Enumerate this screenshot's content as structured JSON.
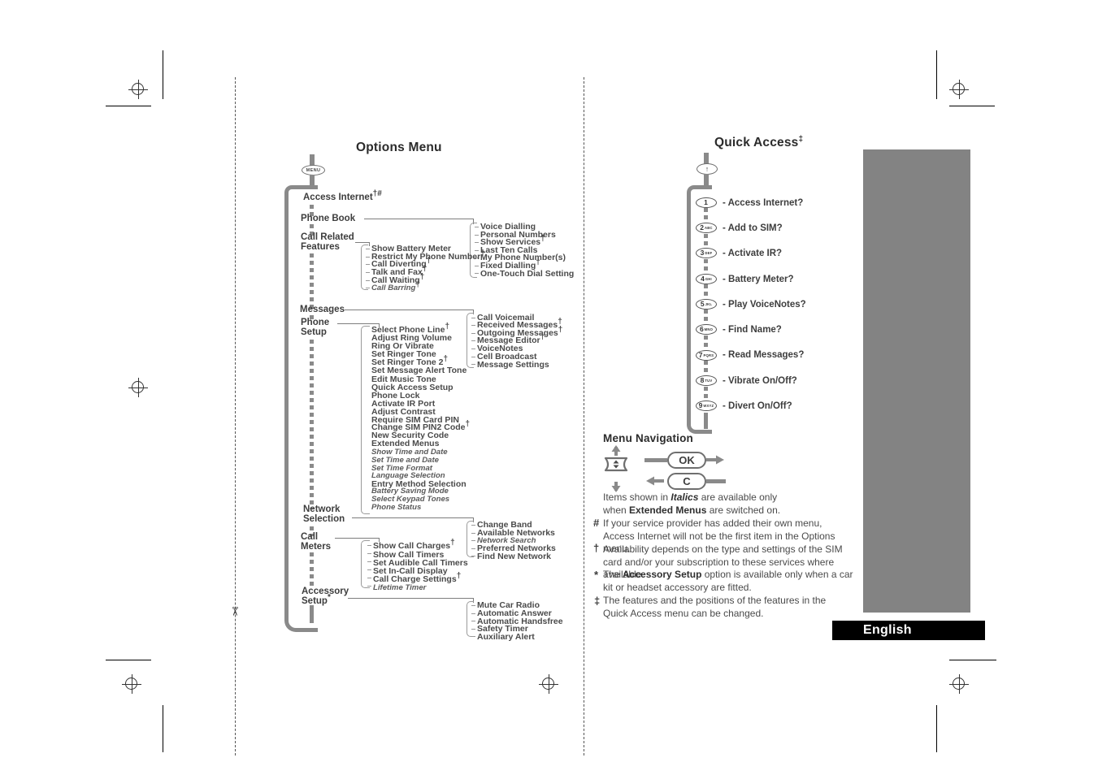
{
  "page": {
    "language_label": "English",
    "cut_icon": "scissors-icon"
  },
  "options_menu": {
    "title": "Options Menu",
    "root_key": "MENU",
    "items": [
      {
        "label": "Access Internet",
        "marks": "†#",
        "children": []
      },
      {
        "label": "Phone Book",
        "marks": "",
        "children": [
          {
            "label": "Voice Dialling",
            "marks": "",
            "italic": false
          },
          {
            "label": "Personal Numbers",
            "marks": "",
            "italic": false
          },
          {
            "label": "Show Services",
            "marks": "†",
            "italic": false
          },
          {
            "label": "Last Ten Calls",
            "marks": "",
            "italic": false
          },
          {
            "label": "My Phone Number(s)",
            "marks": "",
            "italic": false
          },
          {
            "label": "Fixed Dialling",
            "marks": "†",
            "italic": false
          },
          {
            "label": "One-Touch Dial Setting",
            "marks": "",
            "italic": false
          }
        ]
      },
      {
        "label": "Call Related\nFeatures",
        "marks": "",
        "children": [
          {
            "label": "Show Battery Meter",
            "marks": "",
            "italic": false
          },
          {
            "label": "Restrict My Phone Number",
            "marks": "†",
            "italic": false
          },
          {
            "label": "Call Diverting",
            "marks": "†",
            "italic": false
          },
          {
            "label": "Talk and Fax",
            "marks": "†",
            "italic": false
          },
          {
            "label": "Call Waiting",
            "marks": "†",
            "italic": false
          },
          {
            "label": "Call Barring",
            "marks": "†",
            "italic": true
          }
        ]
      },
      {
        "label": "Messages",
        "marks": "",
        "children": [
          {
            "label": "Call Voicemail",
            "marks": "",
            "italic": false
          },
          {
            "label": "Received Messages",
            "marks": "†",
            "italic": false
          },
          {
            "label": "Outgoing Messages",
            "marks": "†",
            "italic": false
          },
          {
            "label": "Message Editor",
            "marks": "†",
            "italic": false
          },
          {
            "label": "VoiceNotes",
            "marks": "",
            "italic": false
          },
          {
            "label": "Cell Broadcast",
            "marks": "",
            "italic": false
          },
          {
            "label": "Message Settings",
            "marks": "",
            "italic": false
          }
        ]
      },
      {
        "label": "Phone\nSetup",
        "marks": "",
        "children": [
          {
            "label": "Select Phone Line",
            "marks": "†",
            "italic": false
          },
          {
            "label": "Adjust Ring Volume",
            "marks": "",
            "italic": false
          },
          {
            "label": "Ring Or Vibrate",
            "marks": "",
            "italic": false
          },
          {
            "label": "Set Ringer Tone",
            "marks": "",
            "italic": false
          },
          {
            "label": "Set Ringer Tone 2",
            "marks": "†",
            "italic": false
          },
          {
            "label": "Set Message Alert Tone",
            "marks": "",
            "italic": false
          },
          {
            "label": "Edit Music Tone",
            "marks": "",
            "italic": false
          },
          {
            "label": "Quick Access Setup",
            "marks": "",
            "italic": false
          },
          {
            "label": "Phone Lock",
            "marks": "",
            "italic": false
          },
          {
            "label": "Activate IR Port",
            "marks": "",
            "italic": false
          },
          {
            "label": "Adjust Contrast",
            "marks": "",
            "italic": false
          },
          {
            "label": "Require SIM Card PIN",
            "marks": "",
            "italic": false
          },
          {
            "label": "Change SIM PIN2 Code",
            "marks": "†",
            "italic": false
          },
          {
            "label": "New Security Code",
            "marks": "",
            "italic": false
          },
          {
            "label": "Extended Menus",
            "marks": "",
            "italic": false
          },
          {
            "label": "Show Time and Date",
            "marks": "",
            "italic": true
          },
          {
            "label": "Set Time and Date",
            "marks": "",
            "italic": true
          },
          {
            "label": "Set Time Format",
            "marks": "",
            "italic": true
          },
          {
            "label": "Language Selection",
            "marks": "",
            "italic": true
          },
          {
            "label": "Entry Method Selection",
            "marks": "",
            "italic": false
          },
          {
            "label": "Battery Saving Mode",
            "marks": "",
            "italic": true
          },
          {
            "label": "Select Keypad Tones",
            "marks": "",
            "italic": true
          },
          {
            "label": "Phone Status",
            "marks": "",
            "italic": true
          }
        ]
      },
      {
        "label": "Network\nSelection",
        "marks": "",
        "children": [
          {
            "label": "Change Band",
            "marks": "",
            "italic": false
          },
          {
            "label": "Available Networks",
            "marks": "",
            "italic": false
          },
          {
            "label": "Network Search",
            "marks": "",
            "italic": true
          },
          {
            "label": "Preferred Networks",
            "marks": "",
            "italic": false
          },
          {
            "label": "Find New Network",
            "marks": "",
            "italic": false
          }
        ]
      },
      {
        "label": "Call\nMeters",
        "marks": "",
        "children": [
          {
            "label": "Show Call Charges",
            "marks": "†",
            "italic": false
          },
          {
            "label": "Show Call Timers",
            "marks": "",
            "italic": false
          },
          {
            "label": "Set Audible Call Timers",
            "marks": "",
            "italic": false
          },
          {
            "label": "Set In-Call Display",
            "marks": "",
            "italic": false
          },
          {
            "label": "Call Charge Settings",
            "marks": "†",
            "italic": false
          },
          {
            "label": "Lifetime Timer",
            "marks": "",
            "italic": true
          }
        ]
      },
      {
        "label": "Accessory\nSetup",
        "marks": "*",
        "children": [
          {
            "label": "Mute Car Radio",
            "marks": "",
            "italic": false
          },
          {
            "label": "Automatic Answer",
            "marks": "",
            "italic": false
          },
          {
            "label": "Automatic Handsfree",
            "marks": "",
            "italic": false
          },
          {
            "label": "Safety Timer",
            "marks": "",
            "italic": false
          },
          {
            "label": "Auxiliary Alert",
            "marks": "",
            "italic": false
          }
        ]
      }
    ]
  },
  "quick_access": {
    "title": "Quick Access",
    "title_mark": "‡",
    "root_key": "↑",
    "items": [
      {
        "digit": "1",
        "letters": "",
        "label": "- Access Internet?"
      },
      {
        "digit": "2",
        "letters": "ABC",
        "label": "- Add to SIM?"
      },
      {
        "digit": "3",
        "letters": "DEF",
        "label": "- Activate IR?"
      },
      {
        "digit": "4",
        "letters": "GHI",
        "label": "- Battery Meter?"
      },
      {
        "digit": "5",
        "letters": "JKL",
        "label": "- Play VoiceNotes?"
      },
      {
        "digit": "6",
        "letters": "MNO",
        "label": "- Find Name?"
      },
      {
        "digit": "7",
        "letters": "PQRS",
        "label": "- Read Messages?"
      },
      {
        "digit": "8",
        "letters": "TUV",
        "label": "- Vibrate On/Off?"
      },
      {
        "digit": "9",
        "letters": "WXYZ",
        "label": "- Divert On/Off?"
      }
    ]
  },
  "menu_navigation": {
    "title": "Menu Navigation",
    "ok_key": "OK",
    "clear_key": "C",
    "up_arrow": "↑",
    "down_arrow": "↓"
  },
  "notes": [
    {
      "mark": "",
      "line1_pre": "Items shown in ",
      "line1_em": "Italics",
      "line1_post": " are available only",
      "line2_pre": "when ",
      "line2_em": "Extended Menus",
      "line2_post": " are switched on."
    },
    {
      "mark": "#",
      "text": "If your service provider has added their own menu, Access Internet will not be the first item in the Options menu."
    },
    {
      "mark": "†",
      "text": "Availability depends on the type and settings of the SIM card and/or your subscription to these services where available."
    },
    {
      "mark": "*",
      "pre": "The ",
      "em": "Accessory Setup",
      "post": " option is available only when a car kit or headset accessory are fitted."
    },
    {
      "mark": "‡",
      "text": "The features and the positions of the features in the Quick Access menu can be changed."
    }
  ]
}
